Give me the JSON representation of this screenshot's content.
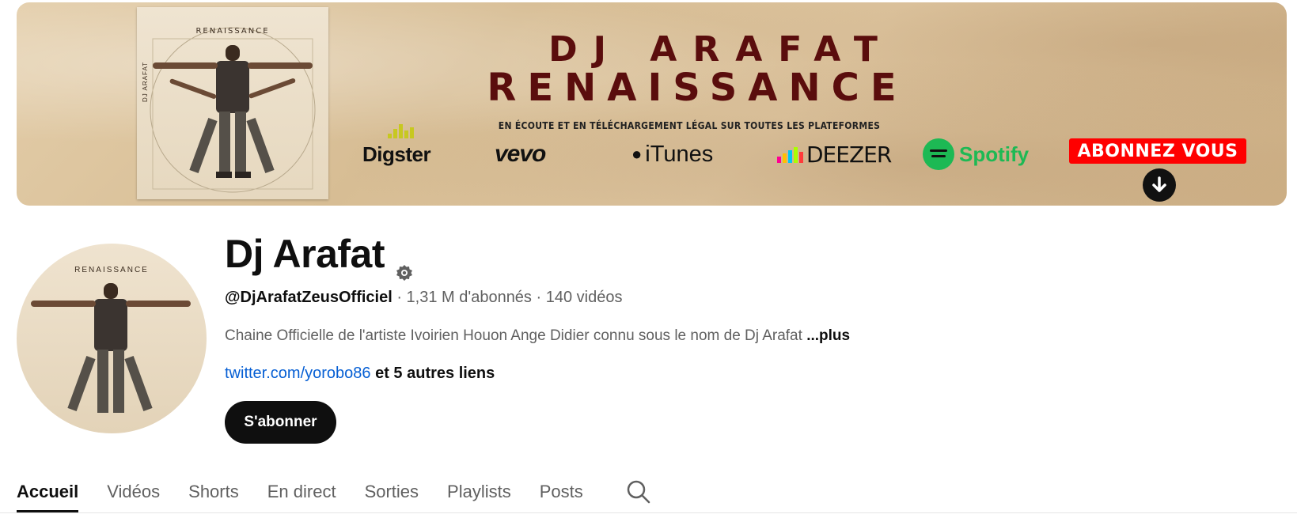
{
  "banner": {
    "album_title": "RENAISSANCE",
    "album_side_text": "DJ ARAFAT",
    "title_line1": "DJ ARAFAT",
    "title_line2": "RENAISSANCE",
    "tagline": "EN ÉCOUTE ET EN TÉLÉCHARGEMENT LÉGAL SUR TOUTES LES PLATEFORMES",
    "platforms": {
      "digster": "Digster",
      "vevo": "vevo",
      "itunes": "iTunes",
      "deezer": "DEEZER",
      "spotify": "Spotify"
    },
    "cta": "ABONNEZ VOUS"
  },
  "avatar": {
    "title": "RENAISSANCE"
  },
  "channel": {
    "name": "Dj Arafat",
    "handle": "@DjArafatZeusOfficiel",
    "subscribers": " · 1,31 M d'abonnés",
    "videos": " · 140 vidéos",
    "description": "Chaine Officielle de l'artiste Ivoirien Houon Ange Didier connu sous le nom de Dj Arafat ",
    "description_more": "...plus",
    "link": "twitter.com/yorobo86",
    "other_links": " et 5 autres liens",
    "subscribe_label": "S'abonner"
  },
  "tabs": [
    {
      "label": "Accueil",
      "active": true
    },
    {
      "label": "Vidéos",
      "active": false
    },
    {
      "label": "Shorts",
      "active": false
    },
    {
      "label": "En direct",
      "active": false
    },
    {
      "label": "Sorties",
      "active": false
    },
    {
      "label": "Playlists",
      "active": false
    },
    {
      "label": "Posts",
      "active": false
    }
  ],
  "icons": {
    "verified": "verified-icon",
    "search": "search-icon",
    "arrow_down": "arrow-down-circle-icon"
  },
  "colors": {
    "subscribe_bg": "#0f0f0f",
    "cta_bg": "#ff0000",
    "link": "#065fd4",
    "title_maroon": "#5a0d0d",
    "spotify_green": "#1db954"
  }
}
